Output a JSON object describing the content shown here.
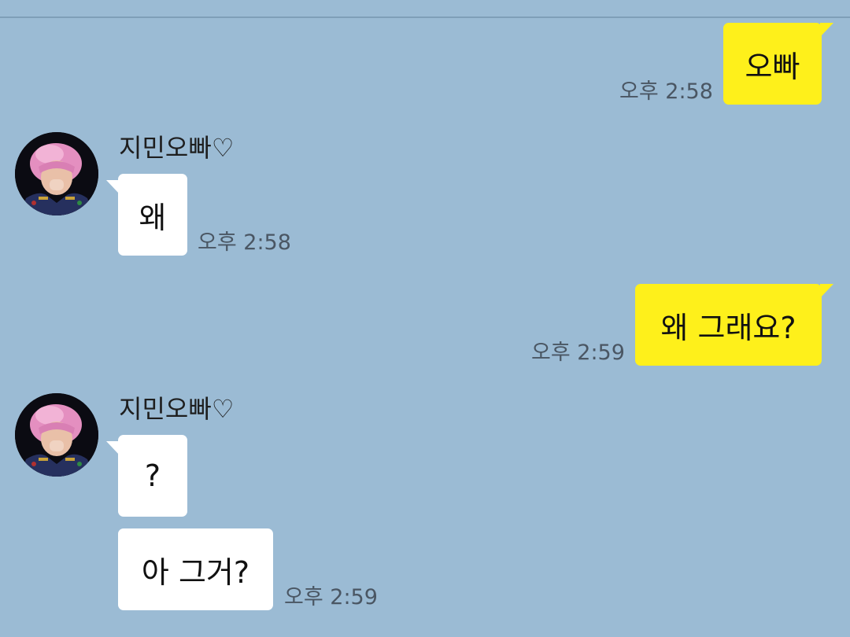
{
  "messages": [
    {
      "side": "me",
      "text": "오빠",
      "time": "오후 2:58"
    },
    {
      "side": "them",
      "sender": "지민오빠♡",
      "text": "왜",
      "time": "오후 2:58"
    },
    {
      "side": "me",
      "text": "왜 그래요?",
      "time": "오후 2:59"
    },
    {
      "side": "them",
      "sender": "지민오빠♡",
      "text": "?"
    },
    {
      "side": "them",
      "text": "아 그거?",
      "time": "오후 2:59"
    }
  ],
  "colors": {
    "background": "#9bbbd4",
    "my_bubble": "#fef01b",
    "their_bubble": "#ffffff"
  },
  "icons": {
    "avatar": "profile-photo-pink-hair"
  }
}
